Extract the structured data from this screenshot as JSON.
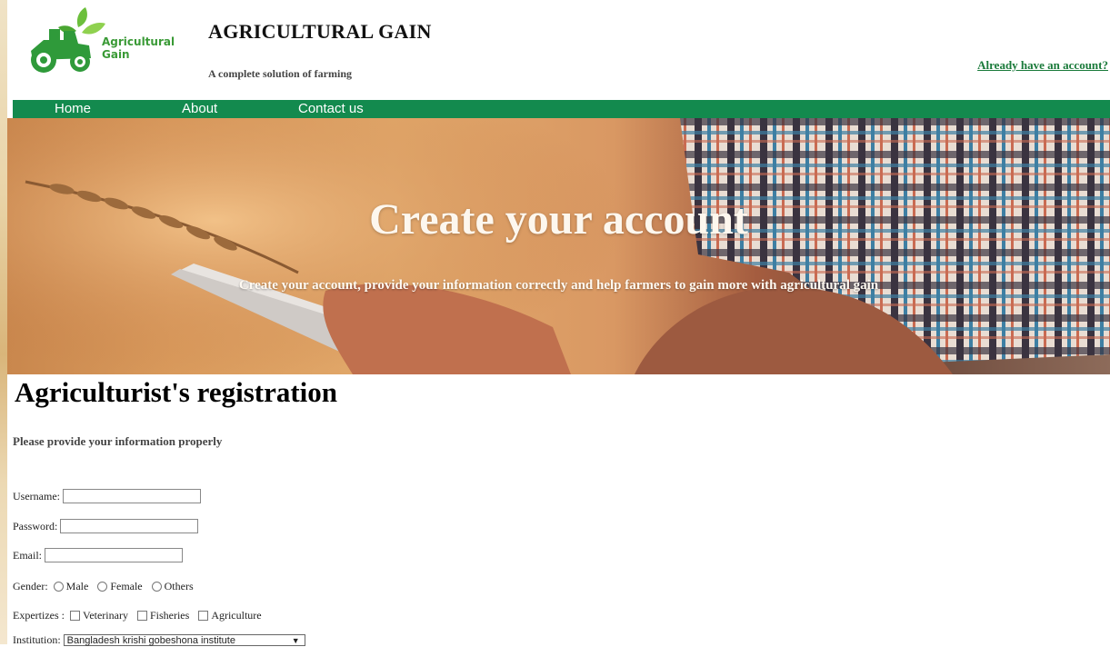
{
  "header": {
    "logo_text_1": "Agricultural",
    "logo_text_2": "Gain",
    "title": "AGRICULTURAL GAIN",
    "tagline": "A complete solution of farming",
    "login_link": "Already have an account?"
  },
  "nav": {
    "items": [
      {
        "label": "Home"
      },
      {
        "label": "About"
      },
      {
        "label": "Contact us"
      }
    ]
  },
  "hero": {
    "title": "Create your account",
    "subtitle": "Create your account, provide your information correctly and help farmers to gain more with agricultural gain"
  },
  "registration": {
    "heading": "Agriculturist's registration",
    "subheading": "Please provide your information properly",
    "username_label": "Username:",
    "password_label": "Password:",
    "email_label": "Email:",
    "gender_label": "Gender:",
    "gender_options": [
      "Male",
      "Female",
      "Others"
    ],
    "expertise_label": "Expertizes :",
    "expertise_options": [
      "Veterinary",
      "Fisheries",
      "Agriculture"
    ],
    "institution_label": "Institution:",
    "institution_selected": "Bangladesh krishi gobeshona institute"
  },
  "colors": {
    "nav_bg": "#138a4e",
    "link": "#1a7a3a",
    "logo_green": "#2e9a3c"
  }
}
